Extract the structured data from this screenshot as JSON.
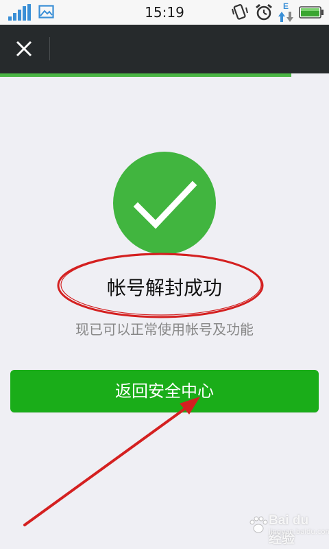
{
  "status_bar": {
    "time": "15:19",
    "network_label": "E",
    "icons": [
      "signal-icon",
      "image-icon",
      "vibrate-icon",
      "alarm-icon",
      "data-transfer-icon",
      "battery-icon"
    ]
  },
  "title_bar": {
    "close_icon": "close-icon"
  },
  "progress": {
    "fraction": 0.885,
    "color": "#4ab544"
  },
  "main": {
    "icon": "check-icon",
    "title": "帐号解封成功",
    "subtitle": "现已可以正常使用帐号及功能",
    "button_label": "返回安全中心"
  },
  "watermark": {
    "brand": "Bai du 经验",
    "url": "jingyan.baidu.com"
  },
  "colors": {
    "accent": "#1aad19",
    "success": "#41b53f",
    "title_bar": "#262a2c",
    "annotation": "#d42020"
  }
}
